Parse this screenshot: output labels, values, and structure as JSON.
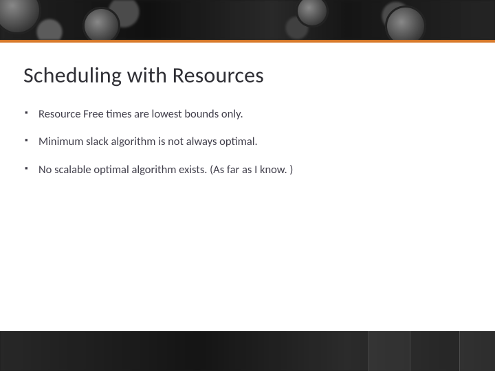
{
  "colors": {
    "accent": "#d7792a",
    "title": "#2f2f35",
    "body": "#413f4b"
  },
  "slide": {
    "title": "Scheduling with Resources",
    "bullets": [
      "Resource Free times are lowest bounds only.",
      "Minimum slack algorithm is not always optimal.",
      "No scalable optimal algorithm exists. (As far as I know. )"
    ]
  }
}
